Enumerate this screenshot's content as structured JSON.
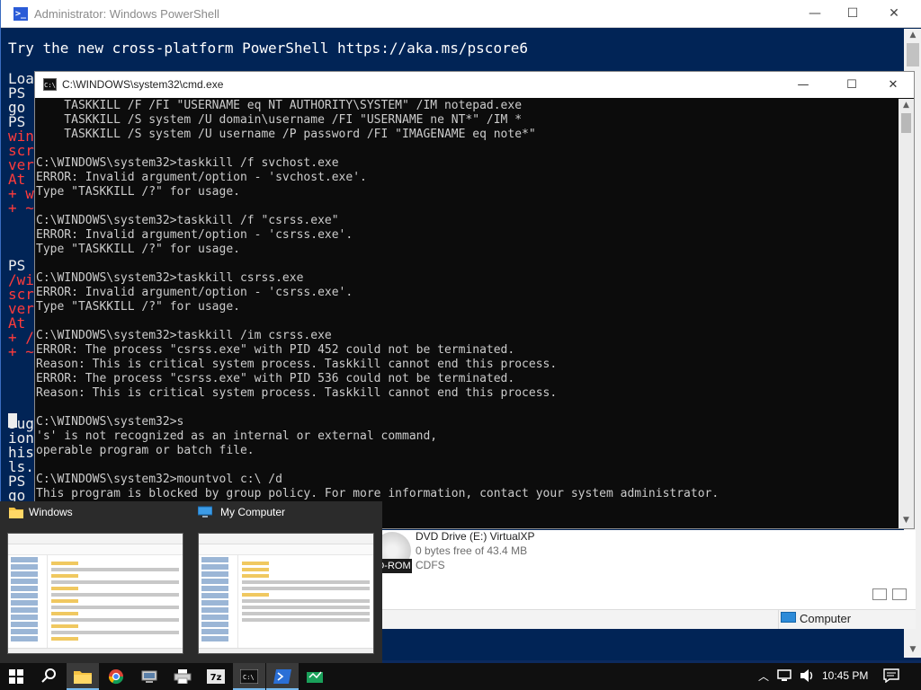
{
  "powershell": {
    "title": "Administrator: Windows PowerShell",
    "banner": "Try the new cross-platform PowerShell https://aka.ms/pscore6",
    "fragments": [
      {
        "text": "Loa",
        "color": "white"
      },
      {
        "text": "PS ",
        "color": "white"
      },
      {
        "text": "go ",
        "color": "white"
      },
      {
        "text": "PS ",
        "color": "white"
      },
      {
        "text": "win",
        "color": "red"
      },
      {
        "text": "scr",
        "color": "red"
      },
      {
        "text": "ver",
        "color": "red"
      },
      {
        "text": "At ",
        "color": "red"
      },
      {
        "text": "+ w",
        "color": "red"
      },
      {
        "text": "+ ~",
        "color": "red"
      },
      {
        "text": "",
        "color": "white"
      },
      {
        "text": "",
        "color": "white"
      },
      {
        "text": "",
        "color": "white"
      },
      {
        "text": "PS ",
        "color": "white"
      },
      {
        "text": "/wi",
        "color": "red"
      },
      {
        "text": "scr",
        "color": "red"
      },
      {
        "text": "ver",
        "color": "red"
      },
      {
        "text": "At ",
        "color": "red"
      },
      {
        "text": "+ /",
        "color": "red"
      },
      {
        "text": "+ ~",
        "color": "red"
      },
      {
        "text": "",
        "color": "white"
      },
      {
        "text": "",
        "color": "white"
      },
      {
        "text": "",
        "color": "white"
      },
      {
        "text": "",
        "color": "white"
      },
      {
        "text": "Sug",
        "color": "white"
      },
      {
        "text": "ion",
        "color": "white"
      },
      {
        "text": "his",
        "color": "white"
      },
      {
        "text": "ls.",
        "color": "white"
      },
      {
        "text": "PS ",
        "color": "white"
      },
      {
        "text": "go ",
        "color": "white"
      }
    ],
    "minimize": "—",
    "maximize": "☐",
    "close": "✕"
  },
  "cmd": {
    "title": "C:\\WINDOWS\\system32\\cmd.exe",
    "icon_text": "C:\\",
    "lines": [
      "    TASKKILL /F /FI \"USERNAME eq NT AUTHORITY\\SYSTEM\" /IM notepad.exe",
      "    TASKKILL /S system /U domain\\username /FI \"USERNAME ne NT*\" /IM *",
      "    TASKKILL /S system /U username /P password /FI \"IMAGENAME eq note*\"",
      "",
      "C:\\WINDOWS\\system32>taskkill /f svchost.exe",
      "ERROR: Invalid argument/option - 'svchost.exe'.",
      "Type \"TASKKILL /?\" for usage.",
      "",
      "C:\\WINDOWS\\system32>taskkill /f \"csrss.exe\"",
      "ERROR: Invalid argument/option - 'csrss.exe'.",
      "Type \"TASKKILL /?\" for usage.",
      "",
      "C:\\WINDOWS\\system32>taskkill csrss.exe",
      "ERROR: Invalid argument/option - 'csrss.exe'.",
      "Type \"TASKKILL /?\" for usage.",
      "",
      "C:\\WINDOWS\\system32>taskkill /im csrss.exe",
      "ERROR: The process \"csrss.exe\" with PID 452 could not be terminated.",
      "Reason: This is critical system process. Taskkill cannot end this process.",
      "ERROR: The process \"csrss.exe\" with PID 536 could not be terminated.",
      "Reason: This is critical system process. Taskkill cannot end this process.",
      "",
      "C:\\WINDOWS\\system32>s",
      "'s' is not recognized as an internal or external command,",
      "operable program or batch file.",
      "",
      "C:\\WINDOWS\\system32>mountvol c:\\ /d",
      "This program is blocked by group policy. For more information, contact your system administrator.",
      "",
      "C:\\WINDOWS\\system32>"
    ],
    "minimize": "—",
    "maximize": "☐",
    "close": "✕"
  },
  "explorer": {
    "dvd_badge": "D-ROM",
    "dvd_name": "DVD Drive (E:) VirtualXP",
    "dvd_free": "0 bytes free of 43.4 MB",
    "dvd_fs": "CDFS",
    "status_location": "Computer"
  },
  "thumbnails": [
    {
      "title": "Windows",
      "icon": "folder-icon"
    },
    {
      "title": "My Computer",
      "icon": "computer-icon"
    }
  ],
  "taskbar": {
    "apps": [
      "file-explorer-icon",
      "chrome-icon",
      "network-drive-icon",
      "printer-icon",
      "7zip-icon",
      "cmd-icon",
      "powershell-icon",
      "app-icon"
    ],
    "tray": [
      "chevron-up-icon",
      "network-icon",
      "volume-icon"
    ],
    "clock": "10:45 PM",
    "notification_icon": "action-center-icon",
    "accent": "#76b9ed"
  },
  "colors": {
    "powershell_bg": "#012456",
    "cmd_bg": "#0c0c0c",
    "error_red": "#ff3b3b"
  }
}
